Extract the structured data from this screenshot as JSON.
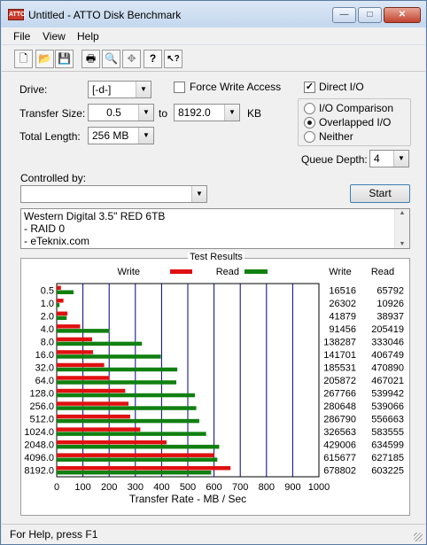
{
  "window": {
    "title": "Untitled - ATTO Disk Benchmark",
    "app_icon_text": "ATTO",
    "buttons": {
      "minimize": "—",
      "maximize": "□",
      "close": "✕"
    }
  },
  "menu": [
    "File",
    "View",
    "Help"
  ],
  "toolbar": {
    "buttons": [
      {
        "name": "new-icon",
        "glyph": "🗋"
      },
      {
        "name": "open-icon",
        "glyph": "📂"
      },
      {
        "name": "save-icon",
        "glyph": "💾"
      },
      {
        "name": "print-icon",
        "glyph": "🖶"
      },
      {
        "name": "print-preview-icon",
        "glyph": "🔍"
      },
      {
        "name": "move-icon",
        "glyph": "✥"
      },
      {
        "name": "help-icon",
        "glyph": "?"
      },
      {
        "name": "context-help-icon",
        "glyph": "↖?"
      }
    ]
  },
  "settings": {
    "drive_label": "Drive:",
    "drive_value": "[-d-]",
    "force_write_label": "Force Write Access",
    "force_write_checked": false,
    "direct_io_label": "Direct I/O",
    "direct_io_checked": true,
    "transfer_size_label": "Transfer Size:",
    "transfer_from": "0.5",
    "to_label": "to",
    "transfer_to": "8192.0",
    "kb_label": "KB",
    "total_length_label": "Total Length:",
    "total_length_value": "256 MB",
    "io_modes": [
      {
        "label": "I/O Comparison",
        "selected": false
      },
      {
        "label": "Overlapped I/O",
        "selected": true
      },
      {
        "label": "Neither",
        "selected": false
      }
    ],
    "queue_depth_label": "Queue Depth:",
    "queue_depth_value": "4",
    "controlled_by_label": "Controlled by:",
    "controlled_by_value": "",
    "start_label": "Start"
  },
  "notes": [
    "Western Digital 3.5\" RED 6TB",
    "- RAID 0",
    "- eTeknix.com"
  ],
  "results": {
    "title": "Test Results",
    "legend_write": "Write",
    "legend_read": "Read",
    "col_write": "Write",
    "col_read": "Read",
    "colors": {
      "write": "#e01010",
      "read": "#108010",
      "grid": "#00008b"
    }
  },
  "chart_data": {
    "type": "bar",
    "title": "Test Results",
    "xlabel": "Transfer Rate - MB / Sec",
    "xlim": [
      0,
      1000
    ],
    "xticks": [
      0,
      100,
      200,
      300,
      400,
      500,
      600,
      700,
      800,
      900,
      1000
    ],
    "categories": [
      "0.5",
      "1.0",
      "2.0",
      "4.0",
      "8.0",
      "16.0",
      "32.0",
      "64.0",
      "128.0",
      "256.0",
      "512.0",
      "1024.0",
      "2048.0",
      "4096.0",
      "8192.0"
    ],
    "series": [
      {
        "name": "Write",
        "values": [
          16.1,
          25.7,
          40.9,
          89.3,
          135.0,
          138.4,
          181.2,
          201.0,
          261.4,
          274.1,
          280.1,
          318.9,
          419.0,
          601.2,
          662.9
        ]
      },
      {
        "name": "Read",
        "values": [
          64.2,
          10.7,
          38.0,
          200.6,
          325.2,
          397.2,
          459.9,
          456.1,
          527.1,
          532.3,
          543.6,
          569.9,
          619.7,
          612.5,
          589.1
        ]
      }
    ],
    "table": {
      "write": [
        "16516",
        "26302",
        "41879",
        "91456",
        "138287",
        "141701",
        "185531",
        "205872",
        "267766",
        "280648",
        "286790",
        "326563",
        "429006",
        "615677",
        "678802"
      ],
      "read": [
        "65792",
        "10926",
        "38937",
        "205419",
        "333046",
        "406749",
        "470890",
        "467021",
        "539942",
        "539066",
        "556663",
        "583555",
        "634599",
        "627185",
        "603225"
      ]
    }
  },
  "status": {
    "text": "For Help, press F1"
  }
}
